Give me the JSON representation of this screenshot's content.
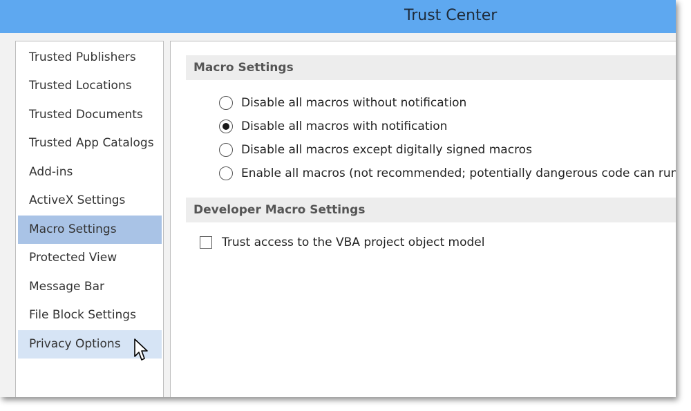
{
  "window": {
    "title": "Trust Center"
  },
  "sidebar": {
    "items": [
      {
        "label": "Trusted Publishers"
      },
      {
        "label": "Trusted Locations"
      },
      {
        "label": "Trusted Documents"
      },
      {
        "label": "Trusted App Catalogs"
      },
      {
        "label": "Add-ins"
      },
      {
        "label": "ActiveX Settings"
      },
      {
        "label": "Macro Settings"
      },
      {
        "label": "Protected View"
      },
      {
        "label": "Message Bar"
      },
      {
        "label": "File Block Settings"
      },
      {
        "label": "Privacy Options"
      }
    ],
    "selected": "Macro Settings",
    "hovered": "Privacy Options"
  },
  "macro_settings": {
    "header": "Macro Settings",
    "options": [
      {
        "label": "Disable all macros without notification",
        "checked": false
      },
      {
        "label": "Disable all macros with notification",
        "checked": true
      },
      {
        "label": "Disable all macros except digitally signed macros",
        "checked": false
      },
      {
        "label": "Enable all macros (not recommended; potentially dangerous code can run)",
        "checked": false
      }
    ]
  },
  "developer_macro_settings": {
    "header": "Developer Macro Settings",
    "trust_vba": {
      "label": "Trust access to the VBA project object model",
      "checked": false
    }
  },
  "colors": {
    "titlebar": "#5ea8f0",
    "selected_item": "#a9c3e6",
    "hover_item": "#d6e4f5"
  },
  "icons": {
    "cursor": "mouse-pointer-icon"
  }
}
